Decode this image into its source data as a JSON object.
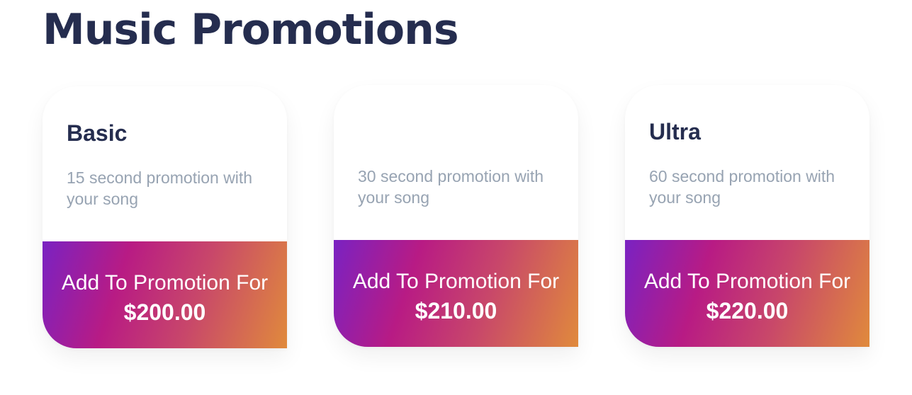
{
  "page": {
    "title": "Music Promotions"
  },
  "colors": {
    "title": "#252d4f",
    "description": "#97a3b2",
    "gradient_start": "#7a22c2",
    "gradient_mid": "#b81b84",
    "gradient_end": "#e08a3c"
  },
  "plans": [
    {
      "name": "Basic",
      "description": "15 second promotion with your song",
      "button_label": "Add To Promotion For",
      "price": "$200.00"
    },
    {
      "name": "",
      "description": "30 second promotion with your song",
      "button_label": "Add To Promotion For",
      "price": "$210.00"
    },
    {
      "name": "Ultra",
      "description": "60 second promotion with your song",
      "button_label": "Add To Promotion For",
      "price": "$220.00"
    }
  ]
}
